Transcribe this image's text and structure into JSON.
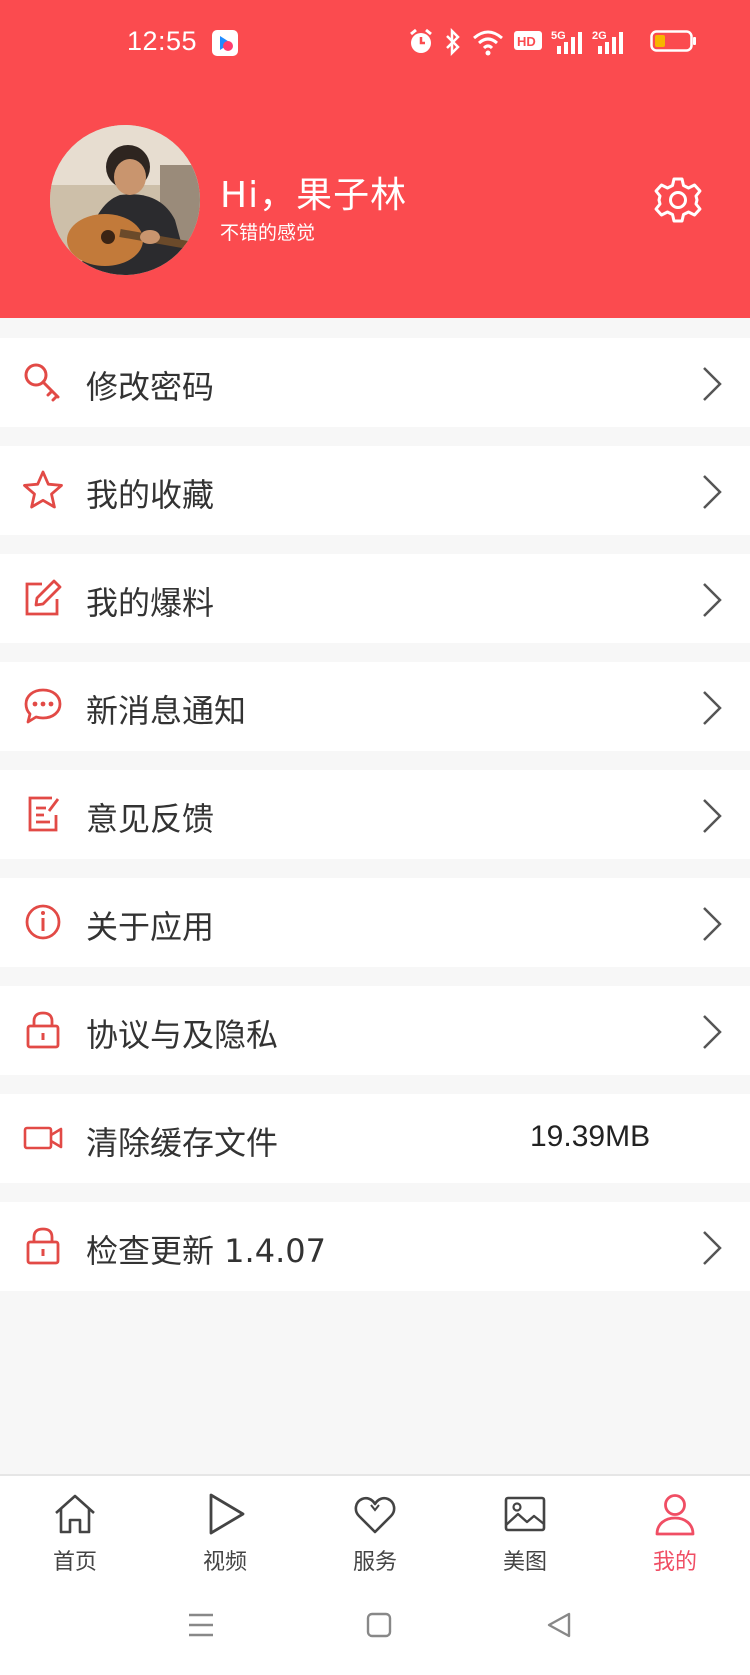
{
  "status_bar": {
    "time": "12:55",
    "icons": [
      "youku-app-icon",
      "alarm-icon",
      "bluetooth-icon",
      "wifi-icon",
      "hd-icon",
      "5g-signal-icon",
      "2g-signal-icon",
      "battery-low-icon"
    ]
  },
  "profile": {
    "greeting": "Hi，果子林",
    "subtitle": "不错的感觉"
  },
  "colors": {
    "header": "#fb4b4f",
    "icon_red": "#e24a46",
    "active_tab": "#f04e64"
  },
  "menu": {
    "items": [
      {
        "label": "修改密码",
        "icon": "key-icon"
      },
      {
        "label": "我的收藏",
        "icon": "star-icon"
      },
      {
        "label": "我的爆料",
        "icon": "edit-icon"
      },
      {
        "label": "新消息通知",
        "icon": "message-icon"
      },
      {
        "label": "意见反馈",
        "icon": "feedback-icon"
      },
      {
        "label": "关于应用",
        "icon": "info-icon"
      },
      {
        "label": "协议与及隐私",
        "icon": "lock-icon"
      },
      {
        "label": "清除缓存文件",
        "icon": "video-icon",
        "value": "19.39MB"
      },
      {
        "label": "检查更新 1.4.07",
        "icon": "lock-icon"
      }
    ]
  },
  "tabs": [
    {
      "label": "首页",
      "icon": "home-icon"
    },
    {
      "label": "视频",
      "icon": "play-icon"
    },
    {
      "label": "服务",
      "icon": "heart-icon"
    },
    {
      "label": "美图",
      "icon": "image-icon"
    },
    {
      "label": "我的",
      "icon": "user-icon",
      "active": true
    }
  ]
}
